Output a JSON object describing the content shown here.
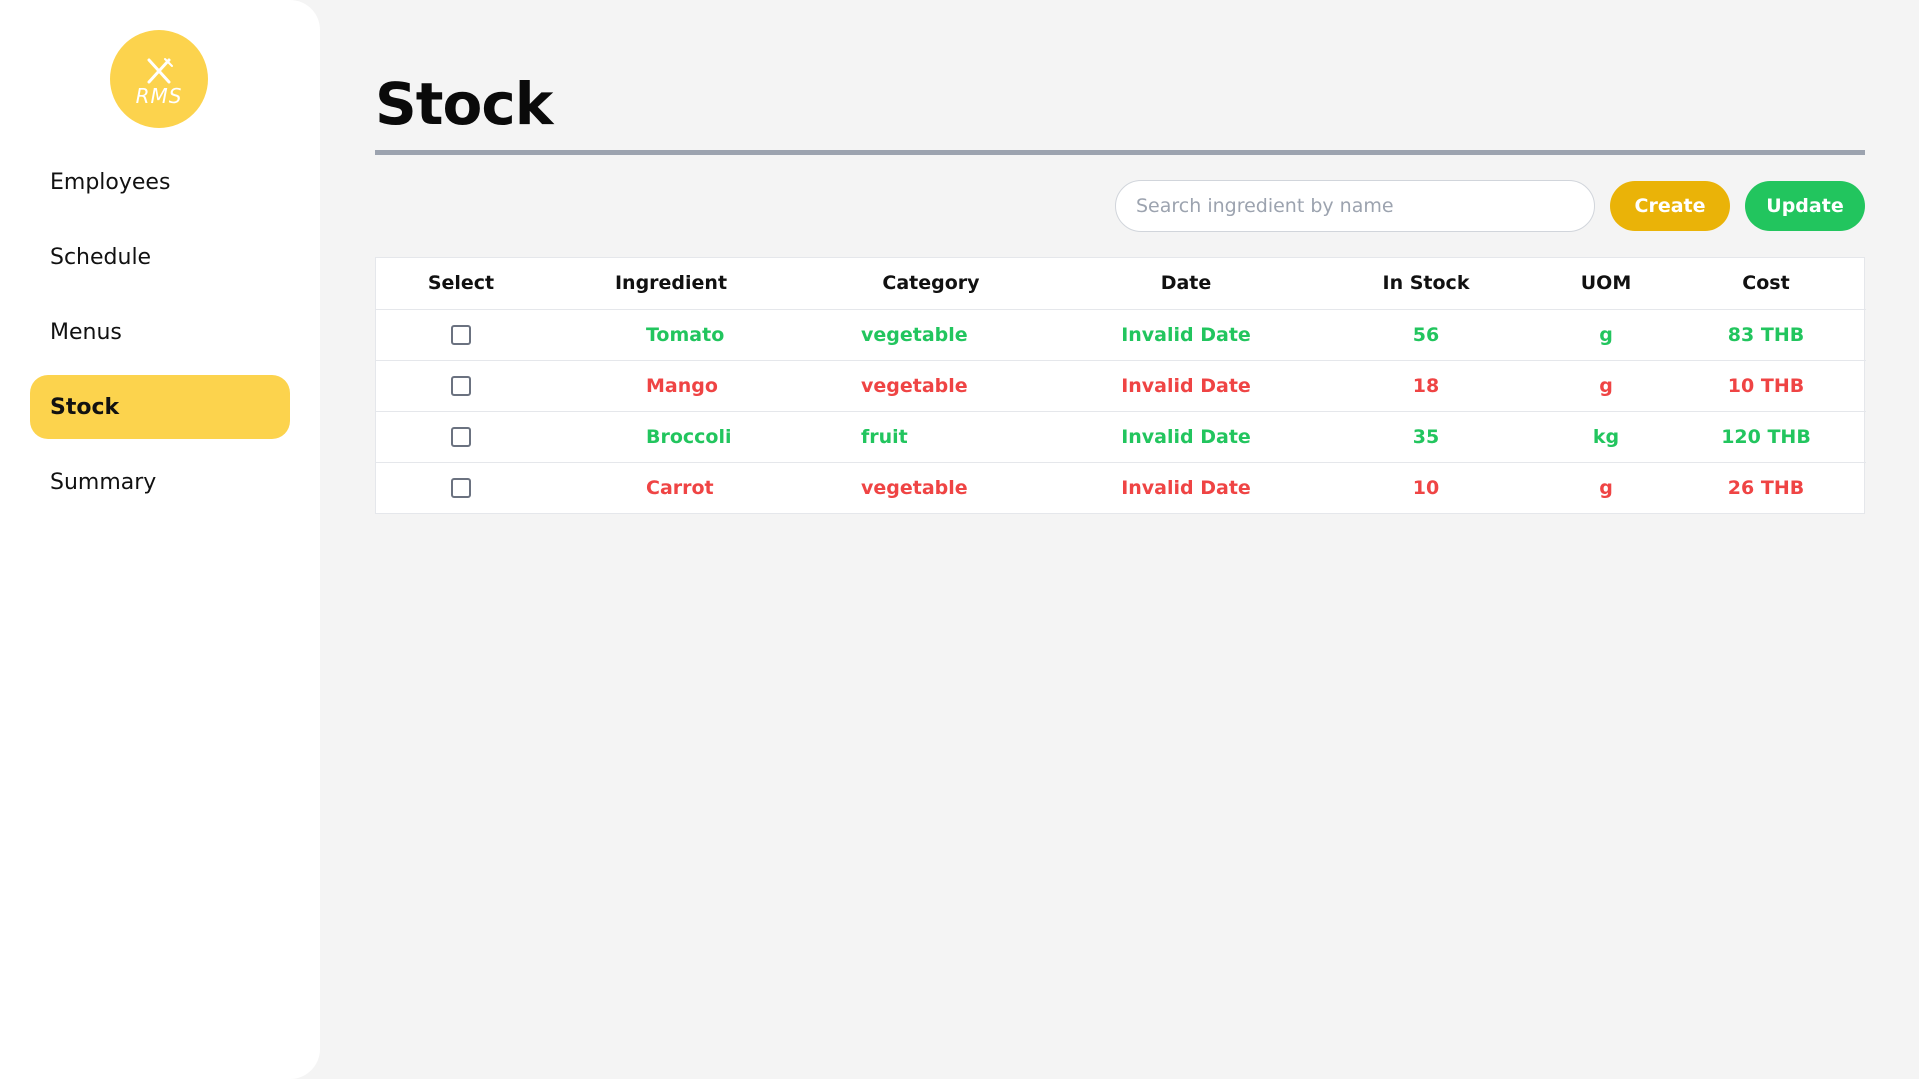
{
  "logo": {
    "text": "RMS"
  },
  "nav": {
    "items": [
      {
        "label": "Employees",
        "active": false
      },
      {
        "label": "Schedule",
        "active": false
      },
      {
        "label": "Menus",
        "active": false
      },
      {
        "label": "Stock",
        "active": true
      },
      {
        "label": "Summary",
        "active": false
      }
    ]
  },
  "page": {
    "title": "Stock"
  },
  "toolbar": {
    "search_placeholder": "Search ingredient by name",
    "create_label": "Create",
    "update_label": "Update"
  },
  "colors": {
    "in_stock": "#22c55e",
    "low_stock": "#ef4444",
    "accent": "#fcd34d",
    "create": "#eab308",
    "update": "#22c55e"
  },
  "table": {
    "headers": [
      "Select",
      "Ingredient",
      "Category",
      "Date",
      "In Stock",
      "UOM",
      "Cost"
    ],
    "rows": [
      {
        "ingredient": "Tomato",
        "category": "vegetable",
        "date": "Invalid Date",
        "in_stock": "56",
        "uom": "g",
        "cost": "83 THB",
        "status": "green"
      },
      {
        "ingredient": "Mango",
        "category": "vegetable",
        "date": "Invalid Date",
        "in_stock": "18",
        "uom": "g",
        "cost": "10 THB",
        "status": "red"
      },
      {
        "ingredient": "Broccoli",
        "category": "fruit",
        "date": "Invalid Date",
        "in_stock": "35",
        "uom": "kg",
        "cost": "120 THB",
        "status": "green"
      },
      {
        "ingredient": "Carrot",
        "category": "vegetable",
        "date": "Invalid Date",
        "in_stock": "10",
        "uom": "g",
        "cost": "26 THB",
        "status": "red"
      }
    ]
  }
}
